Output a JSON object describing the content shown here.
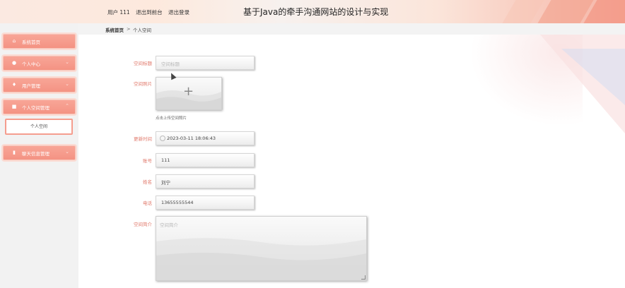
{
  "header": {
    "user_label": "用户 111",
    "back_to_front": "退出到前台",
    "logout": "退出登录",
    "site_title": "基于Java的牵手沟通网站的设计与实现"
  },
  "sidebar": {
    "items": [
      {
        "label": "系统首页",
        "icon": "home-icon"
      },
      {
        "label": "个人中心",
        "icon": "user-icon"
      },
      {
        "label": "用户管理",
        "icon": "user-manage-icon"
      },
      {
        "label": "个人空间管理",
        "icon": "space-icon"
      },
      {
        "label": "聊天信息管理",
        "icon": "chat-icon"
      }
    ],
    "sub_item": "个人空间"
  },
  "breadcrumb": {
    "home": "系统首页",
    "separator": ">",
    "current": "个人空间"
  },
  "form": {
    "space_title": {
      "label": "空间标题",
      "placeholder": "空间标题"
    },
    "space_image": {
      "label": "空间照片",
      "plus": "+",
      "hint": "点击上传空间照片"
    },
    "update_time": {
      "label": "更新时间",
      "value": "2023-03-11 18:06:43"
    },
    "account": {
      "label": "账号",
      "value": "111"
    },
    "name": {
      "label": "姓名",
      "value": "刘宁"
    },
    "phone": {
      "label": "电话",
      "value": "13655555544"
    },
    "intro": {
      "label": "空间简介",
      "placeholder": "空间简介"
    }
  },
  "colors": {
    "accent": "#f49383",
    "label": "#e0786a"
  }
}
